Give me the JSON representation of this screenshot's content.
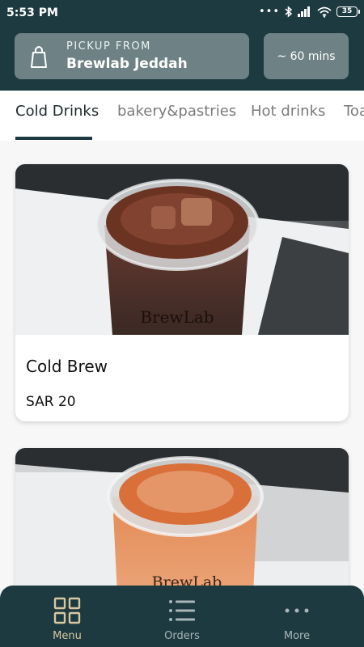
{
  "status_bar": {
    "time": "5:53 PM",
    "battery": "35"
  },
  "header": {
    "pickup_label": "PICKUP FROM",
    "store_name": "Brewlab Jeddah",
    "eta": "~ 60 mins"
  },
  "tabs": [
    {
      "label": "Cold Drinks",
      "active": true
    },
    {
      "label": "bakery&pastries",
      "active": false
    },
    {
      "label": "Hot drinks",
      "active": false
    },
    {
      "label": "Toasts",
      "active": false
    }
  ],
  "products": [
    {
      "name": "Cold Brew",
      "price": "SAR 20",
      "cup_print": "BrewLab"
    },
    {
      "name": "",
      "price": "",
      "cup_print": "BrewLab"
    }
  ],
  "bottom_nav": [
    {
      "label": "Menu",
      "icon": "grid-icon",
      "active": true
    },
    {
      "label": "Orders",
      "icon": "list-icon",
      "active": false
    },
    {
      "label": "More",
      "icon": "more-dots-icon",
      "active": false
    }
  ],
  "colors": {
    "primary_dark": "#1c3a40",
    "header_button": "#6e8285",
    "active_nav": "#d9c7a0"
  }
}
